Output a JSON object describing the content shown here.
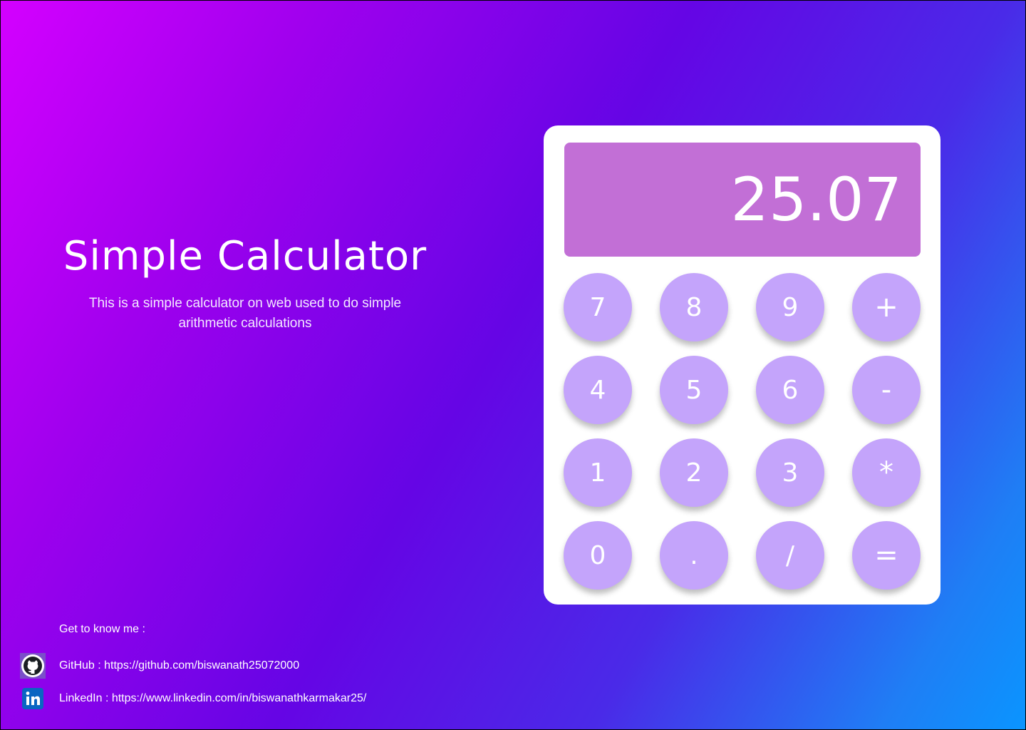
{
  "intro": {
    "title": "Simple Calculator",
    "description": "This is a simple calculator on web used to do simple arithmetic calculations"
  },
  "calculator": {
    "display_value": "25.07",
    "keys": [
      "7",
      "8",
      "9",
      "+",
      "4",
      "5",
      "6",
      "-",
      "1",
      "2",
      "3",
      "*",
      "0",
      ".",
      "/",
      "="
    ],
    "colors": {
      "card": "#ffffff",
      "display": "#c26fd6",
      "key": "#c4a4fb"
    }
  },
  "contact": {
    "heading": "Get to know me :",
    "github": {
      "icon": "github-icon",
      "text": "GitHub : https://github.com/biswanath25072000"
    },
    "linkedin": {
      "icon": "linkedin-icon",
      "text": "LinkedIn : https://www.linkedin.com/in/biswanathkarmakar25/"
    }
  }
}
